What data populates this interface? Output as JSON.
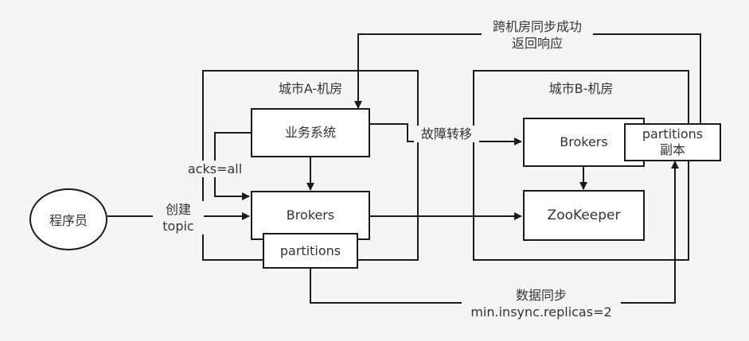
{
  "diagram": {
    "regions": {
      "city_a": "城市A-机房",
      "city_b": "城市B-机房"
    },
    "nodes": {
      "programmer": "程序员",
      "business_system": "业务系统",
      "brokers_a": "Brokers",
      "partitions_a": "partitions",
      "brokers_b": "Brokers",
      "zookeeper": "ZooKeeper",
      "partitions_replica_line1": "partitions",
      "partitions_replica_line2": "副本"
    },
    "edge_labels": {
      "cross_dc_line1": "跨机房同步成功",
      "cross_dc_line2": "返回响应",
      "failover": "故障转移",
      "acks": "acks=all",
      "create_line1": "创建",
      "create_line2": "topic",
      "sync_line1": "数据同步",
      "sync_line2": "min.insync.replicas=2"
    }
  }
}
